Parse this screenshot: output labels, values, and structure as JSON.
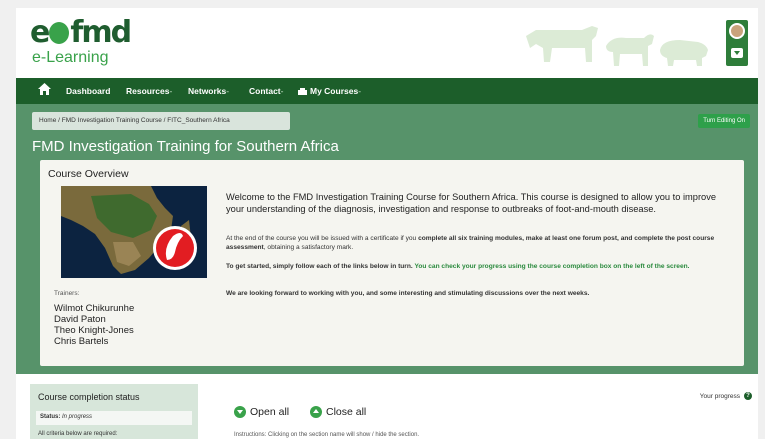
{
  "brand": {
    "logo_main_pre": "e",
    "logo_main_post": "fmd",
    "logo_sub": "e-Learning",
    "primary_color": "#1c5e2a",
    "accent_color": "#39a24a"
  },
  "nav": {
    "home_icon": "home-icon",
    "items": [
      {
        "label": "Dashboard",
        "caret": ""
      },
      {
        "label": "Resources",
        "caret": "-"
      },
      {
        "label": "Networks",
        "caret": "-"
      },
      {
        "label": "Contact",
        "caret": "-"
      },
      {
        "label": "My Courses",
        "caret": "-"
      }
    ]
  },
  "breadcrumb": {
    "items": [
      "Home",
      "FMD Investigation Training Course",
      "FITC_Southern Africa"
    ],
    "separator": " / "
  },
  "edit_button": "Turn Editing On",
  "page_title": "FMD Investigation Training for Southern Africa",
  "overview": {
    "title": "Course Overview",
    "trainers_label": "Trainers:",
    "trainers": [
      "Wilmot Chikurunhe",
      "David Paton",
      "Theo Knight-Jones",
      "Chris Bartels"
    ],
    "welcome": "Welcome to the FMD Investigation Training Course for Southern Africa. This course is designed to allow you to improve your understanding of the diagnosis, investigation and response to outbreaks of foot-and-mouth disease.",
    "p1_a": "At the end of the course you will be issued with a certificate if you ",
    "p1_b": "complete all six training modules, make at least one forum post, and complete the post course assessment",
    "p1_c": ", obtaining a satisfactory mark.",
    "p2_a": "To get started, simply follow each of the links below in turn. ",
    "p2_b": "You can check your progress using the course completion box on the left of the screen.",
    "p3": "We are looking forward to working with you, and some interesting and stimulating discussions over the next weeks."
  },
  "completion": {
    "title": "Course completion status",
    "status_label": "Status:",
    "status_value": "In progress",
    "criteria_note": "All criteria below are required:"
  },
  "controls": {
    "open_all": "Open all",
    "close_all": "Close all",
    "your_progress": "Your progress",
    "help_glyph": "?",
    "instructions": "Instructions: Clicking on the section name will show / hide the section."
  }
}
